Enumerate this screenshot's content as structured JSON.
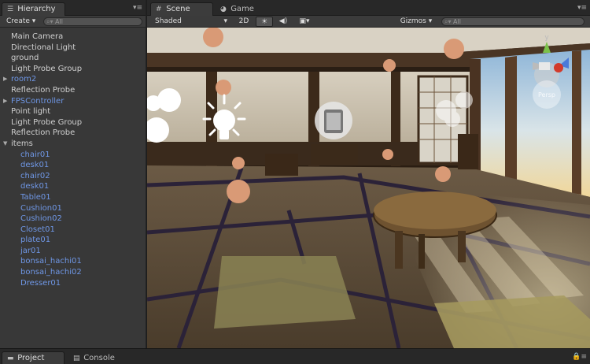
{
  "hierarchy": {
    "tab_label": "Hierarchy",
    "tab_icon": "list-icon",
    "create_label": "Create",
    "search_placeholder": "All",
    "items": [
      {
        "label": "Main Camera",
        "prefab": false,
        "expand": ""
      },
      {
        "label": "Directional Light",
        "prefab": false,
        "expand": ""
      },
      {
        "label": "ground",
        "prefab": false,
        "expand": ""
      },
      {
        "label": "Light Probe Group",
        "prefab": false,
        "expand": ""
      },
      {
        "label": "room2",
        "prefab": true,
        "expand": "▶"
      },
      {
        "label": "Reflection Probe",
        "prefab": false,
        "expand": ""
      },
      {
        "label": "FPSController",
        "prefab": true,
        "expand": "▶"
      },
      {
        "label": "Point light",
        "prefab": false,
        "expand": ""
      },
      {
        "label": "Light Probe Group",
        "prefab": false,
        "expand": ""
      },
      {
        "label": "Reflection Probe",
        "prefab": false,
        "expand": ""
      },
      {
        "label": "items",
        "prefab": false,
        "expand": "▼"
      },
      {
        "label": "chair01",
        "prefab": true,
        "expand": "",
        "child": true
      },
      {
        "label": "desk01",
        "prefab": true,
        "expand": "",
        "child": true
      },
      {
        "label": "chair02",
        "prefab": true,
        "expand": "",
        "child": true
      },
      {
        "label": "desk01",
        "prefab": true,
        "expand": "",
        "child": true
      },
      {
        "label": "Table01",
        "prefab": true,
        "expand": "",
        "child": true
      },
      {
        "label": "Cushion01",
        "prefab": true,
        "expand": "",
        "child": true
      },
      {
        "label": "Cushion02",
        "prefab": true,
        "expand": "",
        "child": true
      },
      {
        "label": "Closet01",
        "prefab": true,
        "expand": "",
        "child": true
      },
      {
        "label": "plate01",
        "prefab": true,
        "expand": "",
        "child": true
      },
      {
        "label": "jar01",
        "prefab": true,
        "expand": "",
        "child": true
      },
      {
        "label": "bonsai_hachi01",
        "prefab": true,
        "expand": "",
        "child": true
      },
      {
        "label": "bonsai_hachi02",
        "prefab": true,
        "expand": "",
        "child": true
      },
      {
        "label": "Dresser01",
        "prefab": true,
        "expand": "",
        "child": true
      }
    ],
    "colors": {
      "normal_text": "#cfcfcf",
      "prefab_text": "#6f97e6"
    }
  },
  "scene": {
    "scene_tab": "Scene",
    "scene_tab_icon": "grid-icon",
    "game_tab": "Game",
    "game_tab_icon": "pacman-icon",
    "shading_mode": "Shaded",
    "mode_2d": "2D",
    "lighting_icon": "sun-icon",
    "audio_icon": "speaker-icon",
    "effects_icon": "image-icon",
    "gizmos_label": "Gizmos",
    "search_placeholder": "All",
    "gizmo_axis_label": "y",
    "gizmo_view_label": "Persp"
  },
  "bottom": {
    "project_tab": "Project",
    "project_icon": "folder-icon",
    "console_tab": "Console",
    "console_icon": "console-icon"
  }
}
